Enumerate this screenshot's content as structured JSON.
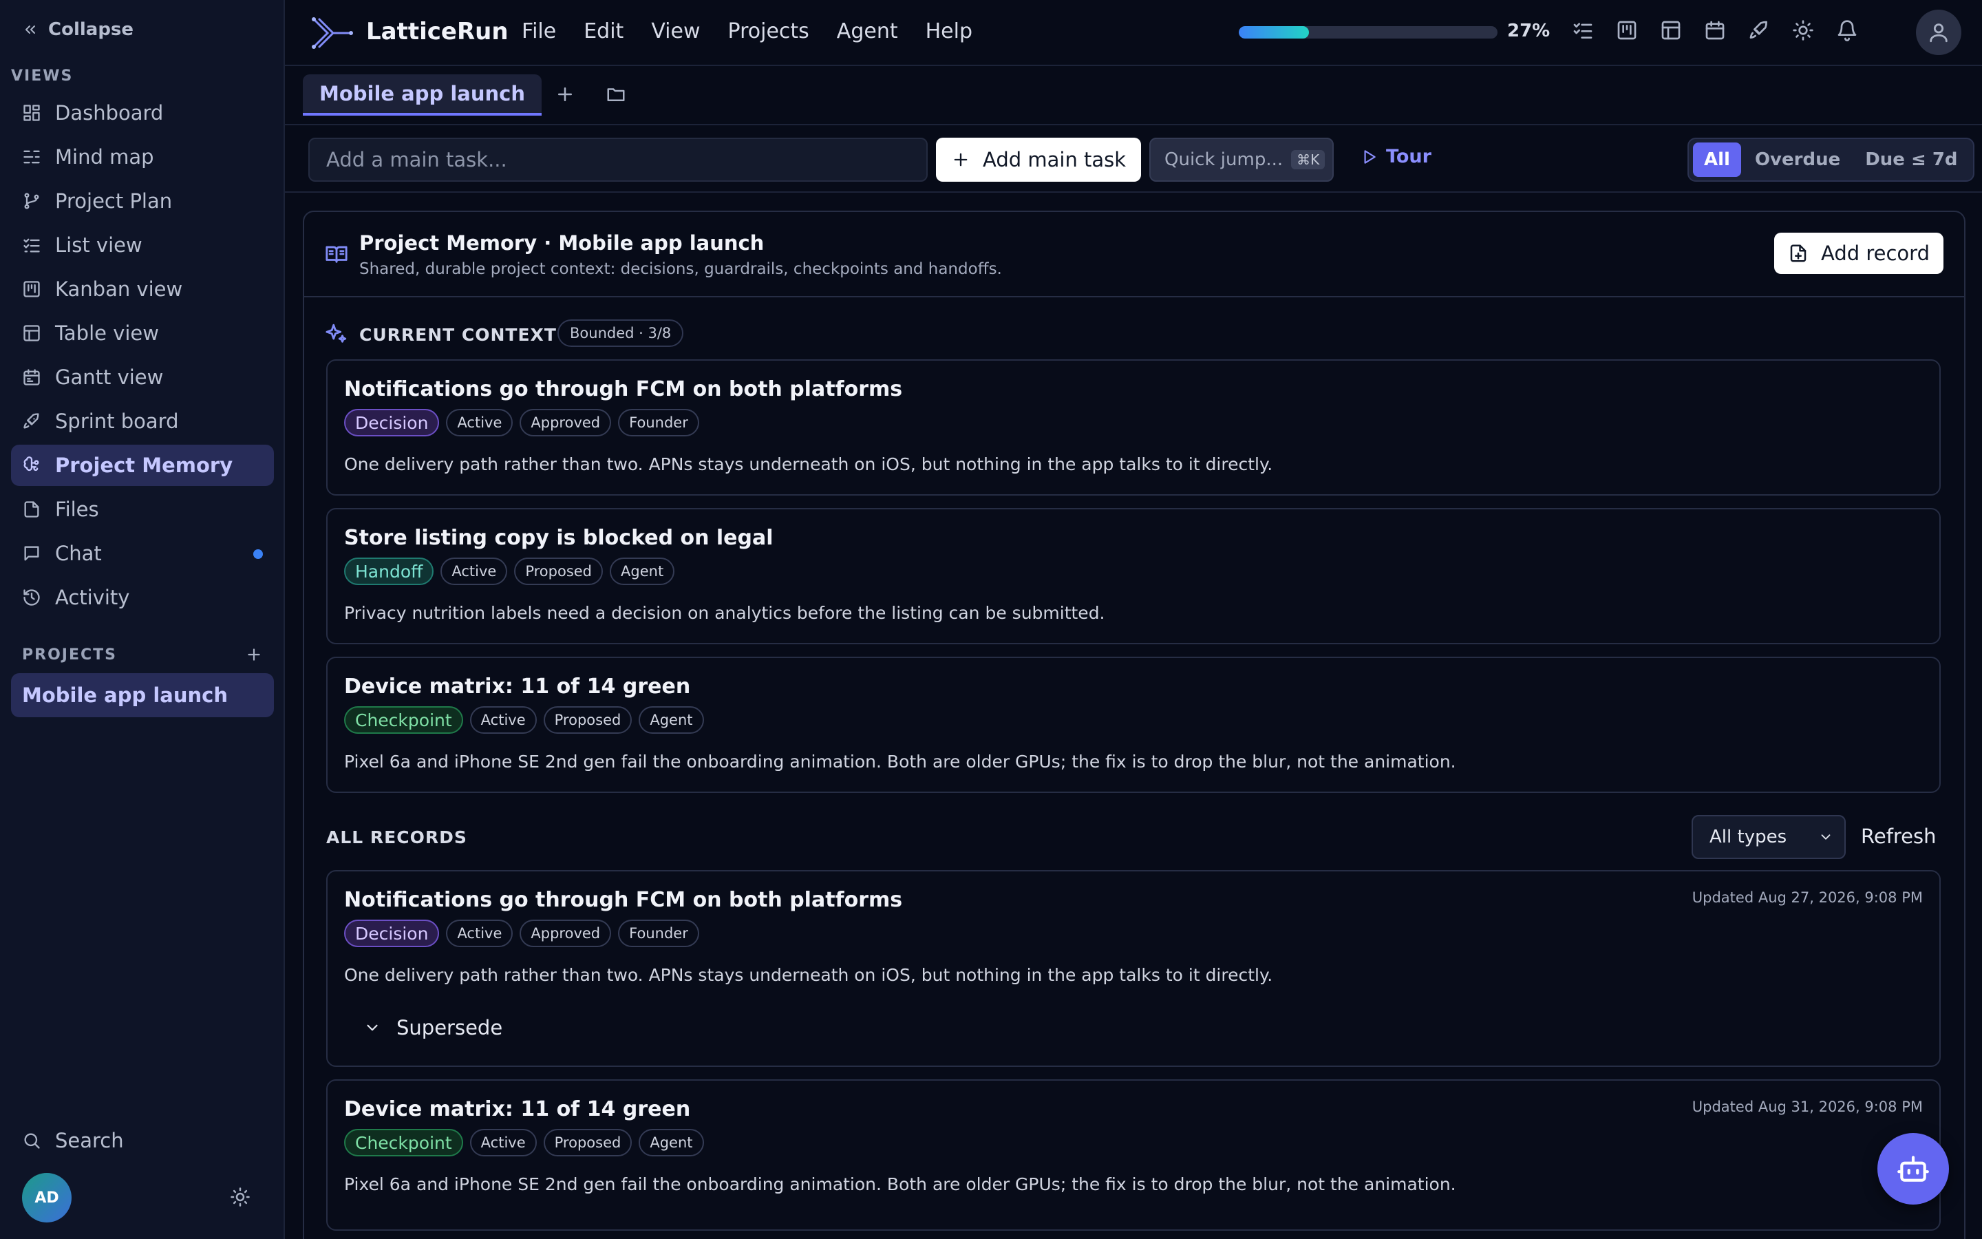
{
  "sidebar": {
    "collapse_label": "Collapse",
    "views_label": "VIEWS",
    "items": [
      {
        "label": "Dashboard"
      },
      {
        "label": "Mind map"
      },
      {
        "label": "Project Plan"
      },
      {
        "label": "List view"
      },
      {
        "label": "Kanban view"
      },
      {
        "label": "Table view"
      },
      {
        "label": "Gantt view"
      },
      {
        "label": "Sprint board"
      },
      {
        "label": "Project Memory"
      },
      {
        "label": "Files"
      },
      {
        "label": "Chat"
      },
      {
        "label": "Activity"
      }
    ],
    "projects_label": "PROJECTS",
    "project": "Mobile app launch",
    "search_label": "Search",
    "avatar_initials": "AD"
  },
  "topbar": {
    "brand": "LatticeRun",
    "menu": [
      "File",
      "Edit",
      "View",
      "Projects",
      "Agent",
      "Help"
    ],
    "progress_percent": 27,
    "progress_label": "27%"
  },
  "tabs": {
    "active": "Mobile app launch"
  },
  "toolbar": {
    "main_task_placeholder": "Add a main task...",
    "add_main_label": "Add main task",
    "quick_jump_label": "Quick jump...",
    "quick_jump_kbd": "⌘K",
    "tour_label": "Tour",
    "filters": [
      "All",
      "Overdue",
      "Due ≤ 7d"
    ]
  },
  "memory": {
    "title": "Project Memory · Mobile app launch",
    "subtitle": "Shared, durable project context: decisions, guardrails, checkpoints and handoffs.",
    "add_record_label": "Add record",
    "current_context_label": "CURRENT CONTEXT",
    "bounded_label": "Bounded · 3/8",
    "context_cards": [
      {
        "title": "Notifications go through FCM on both platforms",
        "type": "Decision",
        "tags": [
          "Active",
          "Approved",
          "Founder"
        ],
        "body": "One delivery path rather than two. APNs stays underneath on iOS, but nothing in the app talks to it directly."
      },
      {
        "title": "Store listing copy is blocked on legal",
        "type": "Handoff",
        "tags": [
          "Active",
          "Proposed",
          "Agent"
        ],
        "body": "Privacy nutrition labels need a decision on analytics before the listing can be submitted."
      },
      {
        "title": "Device matrix: 11 of 14 green",
        "type": "Checkpoint",
        "tags": [
          "Active",
          "Proposed",
          "Agent"
        ],
        "body": "Pixel 6a and iPhone SE 2nd gen fail the onboarding animation. Both are older GPUs; the fix is to drop the blur, not the animation."
      }
    ],
    "all_records_label": "ALL RECORDS",
    "type_filter": "All types",
    "refresh_label": "Refresh",
    "records": [
      {
        "title": "Notifications go through FCM on both platforms",
        "updated": "Updated Aug 27, 2026, 9:08 PM",
        "type": "Decision",
        "tags": [
          "Active",
          "Approved",
          "Founder"
        ],
        "body": "One delivery path rather than two. APNs stays underneath on iOS, but nothing in the app talks to it directly.",
        "supersede_label": "Supersede"
      },
      {
        "title": "Device matrix: 11 of 14 green",
        "updated": "Updated Aug 31, 2026, 9:08 PM",
        "type": "Checkpoint",
        "tags": [
          "Active",
          "Proposed",
          "Agent"
        ],
        "body": "Pixel 6a and iPhone SE 2nd gen fail the onboarding animation. Both are older GPUs; the fix is to drop the blur, not the animation."
      }
    ]
  },
  "colors": {
    "accent": "#6366f1",
    "background": "#070b18",
    "sidebar": "#0e1427",
    "decision": "#6b4fc4",
    "handoff": "#1f7a70",
    "checkpoint": "#1f7a4a"
  }
}
